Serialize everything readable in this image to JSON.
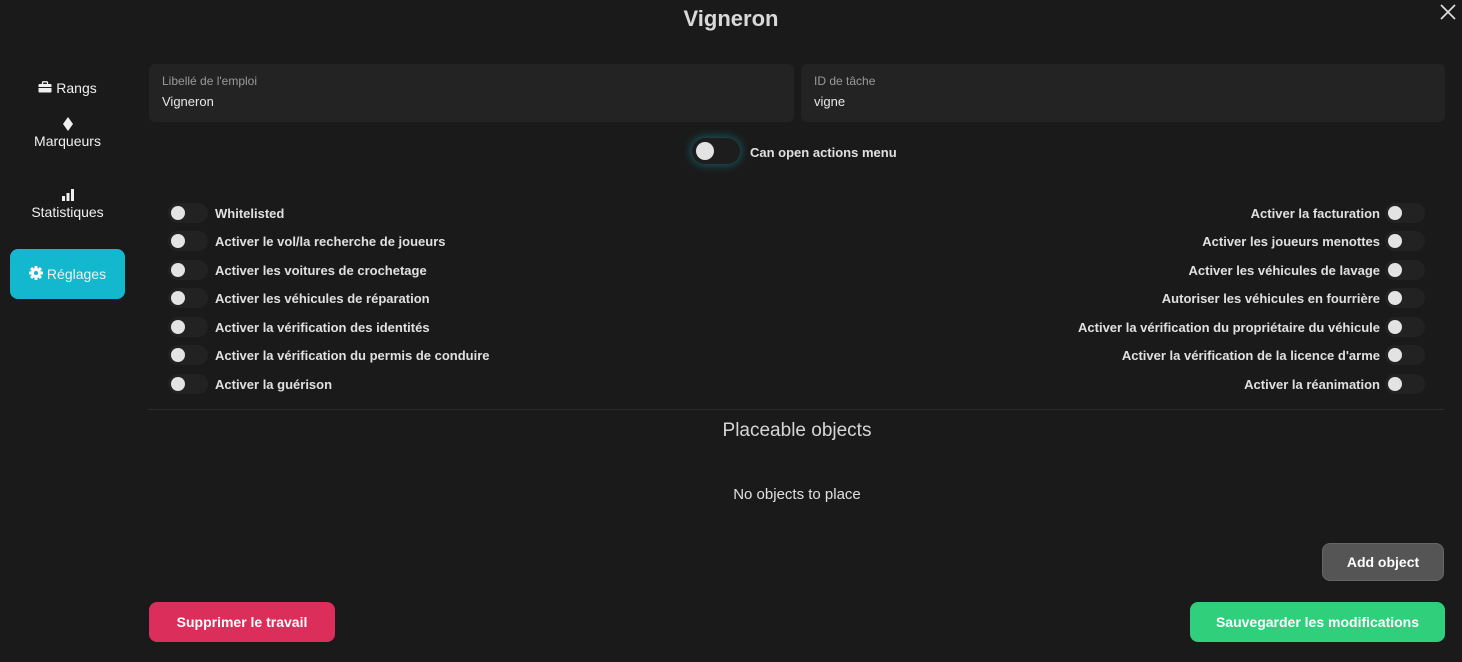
{
  "header": {
    "title": "Vigneron"
  },
  "sidebar": {
    "items": [
      {
        "label": "Rangs",
        "icon": "briefcase-icon"
      },
      {
        "label": "Marqueurs",
        "icon": "diamond-icon"
      },
      {
        "label": "Statistiques",
        "icon": "bar-chart-icon"
      },
      {
        "label": "Réglages",
        "icon": "gear-icon",
        "active": true
      }
    ]
  },
  "form": {
    "job_label": {
      "label": "Libellé de l'emploi",
      "value": "Vigneron"
    },
    "job_id": {
      "label": "ID de tâche",
      "value": "vigne"
    }
  },
  "actions_menu": {
    "label": "Can open actions menu",
    "enabled": false
  },
  "permissions": {
    "left": [
      {
        "label": "Whitelisted",
        "enabled": false
      },
      {
        "label": "Activer le vol/la recherche de joueurs",
        "enabled": false
      },
      {
        "label": "Activer les voitures de crochetage",
        "enabled": false
      },
      {
        "label": "Activer les véhicules de réparation",
        "enabled": false
      },
      {
        "label": "Activer la vérification des identités",
        "enabled": false
      },
      {
        "label": "Activer la vérification du permis de conduire",
        "enabled": false
      },
      {
        "label": "Activer la guérison",
        "enabled": false
      }
    ],
    "right": [
      {
        "label": "Activer la facturation",
        "enabled": false
      },
      {
        "label": "Activer les joueurs menottes",
        "enabled": false
      },
      {
        "label": "Activer les véhicules de lavage",
        "enabled": false
      },
      {
        "label": "Autoriser les véhicules en fourrière",
        "enabled": false
      },
      {
        "label": "Activer la vérification du propriétaire du véhicule",
        "enabled": false
      },
      {
        "label": "Activer la vérification de la licence d'arme",
        "enabled": false
      },
      {
        "label": "Activer la réanimation",
        "enabled": false
      }
    ]
  },
  "placeable": {
    "title": "Placeable objects",
    "empty_text": "No objects to place",
    "add_label": "Add object"
  },
  "footer": {
    "delete_label": "Supprimer le travail",
    "save_label": "Sauvegarder les modifications"
  },
  "colors": {
    "background": "#1a1a1a",
    "accent": "#13b8cf",
    "danger": "#dc2e5a",
    "success": "#2fcf7c"
  }
}
